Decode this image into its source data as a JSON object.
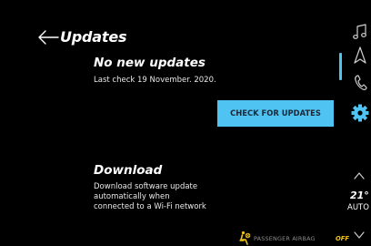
{
  "header": {
    "back_icon": "arrow-left-icon",
    "title": "Updates"
  },
  "status": {
    "heading": "No new updates",
    "last_check": "Last check 19 November. 2020."
  },
  "actions": {
    "check_label": "CHECK FOR UPDATES",
    "accent_color": "#4fc3f2"
  },
  "download": {
    "heading": "Download",
    "description_lines": [
      "Download software update",
      "automatically when",
      "connected to a Wi-Fi network"
    ]
  },
  "airbag": {
    "icon": "passenger-airbag-icon",
    "label": "PASSENGER AIRBAG",
    "state": "OFF",
    "state_color": "#f0c419"
  },
  "sidebar": {
    "icons": [
      "music-note-icon",
      "navigation-icon",
      "phone-icon",
      "settings-gear-icon"
    ],
    "active": "settings-gear-icon"
  },
  "climate": {
    "temperature": "21°",
    "mode": "AUTO",
    "up_icon": "chevron-up-icon",
    "down_icon": "chevron-down-icon"
  }
}
